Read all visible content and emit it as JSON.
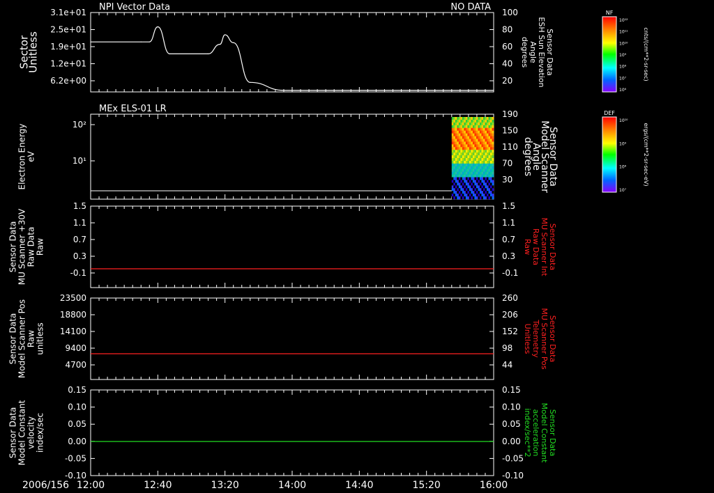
{
  "date_label": "2006/156",
  "time_ticks": [
    "12:00",
    "12:40",
    "13:20",
    "14:00",
    "14:40",
    "15:20",
    "16:00"
  ],
  "colors": {
    "white": "#ffffff",
    "red": "#ff2020",
    "green": "#22dd22",
    "bg": "#000000"
  },
  "panels": [
    {
      "title_left": "NPI Vector Data",
      "title_right": "NO DATA",
      "left_label": [
        "Sector",
        "Unitless"
      ],
      "left_ticks": [
        "3.1e+01",
        "2.5e+01",
        "1.9e+01",
        "1.2e+01",
        "6.2e+00"
      ],
      "right_label": [
        "Sensor Data",
        "ESH Sun Elevation",
        "Angle",
        "degrees"
      ],
      "right_label_color": "#ffffff",
      "right_ticks": [
        "100",
        "80",
        "60",
        "40",
        "20"
      ]
    },
    {
      "title_left": "MEx ELS-01 LR",
      "title_right": "",
      "left_label": [
        "Electron Energy",
        "eV"
      ],
      "left_ticks": [
        "10²",
        "10¹"
      ],
      "right_label": [
        "Sensor Data",
        "Model Scanner",
        "Angle",
        "degrees"
      ],
      "right_label_color": "#ffffff",
      "right_ticks": [
        "190",
        "150",
        "110",
        "70",
        "30"
      ]
    },
    {
      "title_left": "",
      "title_right": "",
      "left_label": [
        "Sensor Data",
        "MU Scanner +30V",
        "Raw Data",
        "Raw"
      ],
      "left_ticks": [
        "1.5",
        "1.1",
        "0.7",
        "0.3",
        "-0.1"
      ],
      "right_label": [
        "Sensor Data",
        "MU Scanner Int",
        "Raw Data",
        "Raw"
      ],
      "right_label_color": "#ff2020",
      "right_ticks": [
        "1.5",
        "1.1",
        "0.7",
        "0.3",
        "-0.1"
      ]
    },
    {
      "title_left": "",
      "title_right": "",
      "left_label": [
        "Sensor Data",
        "Model Scanner Pos",
        "Raw",
        "unitless"
      ],
      "left_ticks": [
        "23500",
        "18800",
        "14100",
        "9400",
        "4700"
      ],
      "right_label": [
        "Sensor Data",
        "MU Scanner Pos",
        "Telemetry",
        "Unitless"
      ],
      "right_label_color": "#ff2020",
      "right_ticks": [
        "260",
        "206",
        "152",
        "98",
        "44"
      ]
    },
    {
      "title_left": "",
      "title_right": "",
      "left_label": [
        "Sensor Data",
        "Model Constant",
        "velocity",
        "index/sec"
      ],
      "left_ticks": [
        "0.15",
        "0.10",
        "0.05",
        "0.00",
        "-0.05",
        "-0.10"
      ],
      "right_label": [
        "Sensor Data",
        "Model Constant",
        "acceleration",
        "index/sec**2"
      ],
      "right_label_color": "#22dd22",
      "right_ticks": [
        "0.15",
        "0.10",
        "0.05",
        "0.00",
        "-0.05",
        "-0.10"
      ]
    }
  ],
  "colorbars": [
    {
      "title": "NF",
      "unit": "cnts/(cm**2-sr-sec)",
      "ticks": [
        "10¹²",
        "10¹¹",
        "10¹⁰",
        "10⁹",
        "10⁸",
        "10⁷",
        "10⁶"
      ]
    },
    {
      "title": "DEF",
      "unit": "ergs/(cm**2-sr-sec-eV)",
      "ticks": [
        "10¹⁰",
        "10⁹",
        "10⁸",
        "10⁷"
      ]
    }
  ],
  "chart_data": [
    {
      "type": "line",
      "x_range": [
        "12:00",
        "16:00"
      ],
      "x": [
        "12:00",
        "12:30",
        "12:35",
        "12:40",
        "12:47",
        "13:10",
        "13:17",
        "13:20",
        "13:25",
        "13:35",
        "13:55",
        "16:00"
      ],
      "series": [
        {
          "values": [
            63,
            63,
            63,
            82,
            48,
            48,
            60,
            72,
            62,
            12,
            2,
            2
          ],
          "color": "#ffffff"
        }
      ],
      "ylim_right": [
        0,
        100
      ]
    },
    {
      "type": "heatmap",
      "x_range": [
        "15:35",
        "16:00"
      ],
      "energy_range_eV": [
        1.2,
        180
      ]
    },
    {
      "type": "line",
      "x": [
        "12:00",
        "16:00"
      ],
      "series": [
        {
          "values": [
            0.0,
            0.0
          ],
          "color": "#ff2020"
        }
      ],
      "ylim": [
        -0.1,
        1.5
      ]
    },
    {
      "type": "line",
      "x": [
        "12:00",
        "16:00"
      ],
      "series": [
        {
          "values": [
            7700,
            7700
          ],
          "color": "#ff2020"
        }
      ],
      "ylim": [
        4700,
        23500
      ]
    },
    {
      "type": "line",
      "x": [
        "12:00",
        "16:00"
      ],
      "series": [
        {
          "values": [
            0.0,
            0.0
          ],
          "color": "#22dd22"
        }
      ],
      "ylim": [
        -0.1,
        0.15
      ]
    }
  ]
}
